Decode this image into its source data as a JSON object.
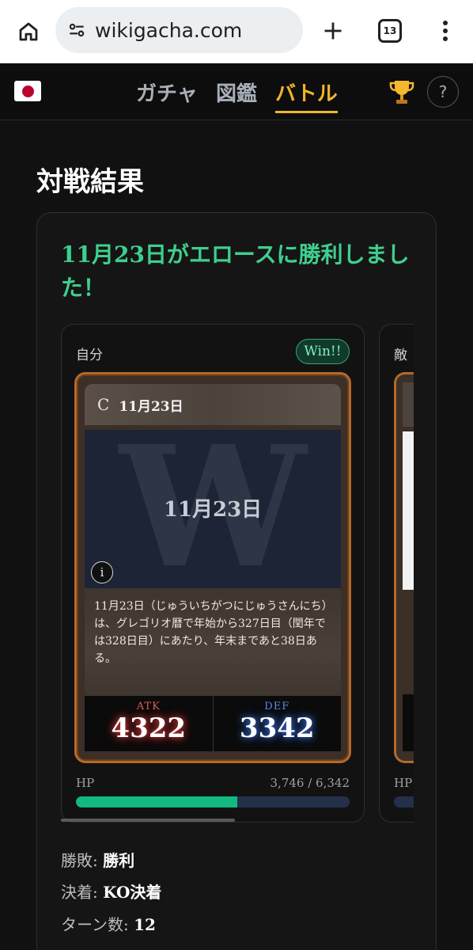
{
  "browser": {
    "url": "wikigacha.com",
    "tab_count": "13"
  },
  "nav": {
    "tabs": [
      "ガチャ",
      "図鑑",
      "バトル"
    ],
    "active_tab": "バトル"
  },
  "page": {
    "title": "対戦結果",
    "headline": "11月23日がエロースに勝利しました！"
  },
  "my_side": {
    "label": "自分",
    "badge": "Win!!",
    "card": {
      "rarity": "C",
      "name": "11月23日",
      "art_letter": "W",
      "art_title": "11月23日",
      "description": "11月23日（じゅういちがつにじゅうさんにち）は、グレゴリオ暦で年始から327日目（閏年では328日目）にあたり、年末まであと38日ある。",
      "atk_label": "ATK",
      "atk": "4322",
      "def_label": "DEF",
      "def": "3342"
    },
    "hp_label": "HP",
    "hp_text": "3,746 / 6,342",
    "hp_fraction": 0.59
  },
  "enemy_side": {
    "label": "敵",
    "hp_label": "HP"
  },
  "result": {
    "outcome_label": "勝敗:",
    "outcome": "勝利",
    "decision_label": "決着:",
    "decision": "KO決着",
    "turns_label": "ターン数:",
    "turns": "12"
  },
  "colors": {
    "accent_green": "#3ecf8e",
    "nav_active": "#f0b429",
    "hp_fill": "#13b981",
    "card_border": "#b26a2a"
  }
}
